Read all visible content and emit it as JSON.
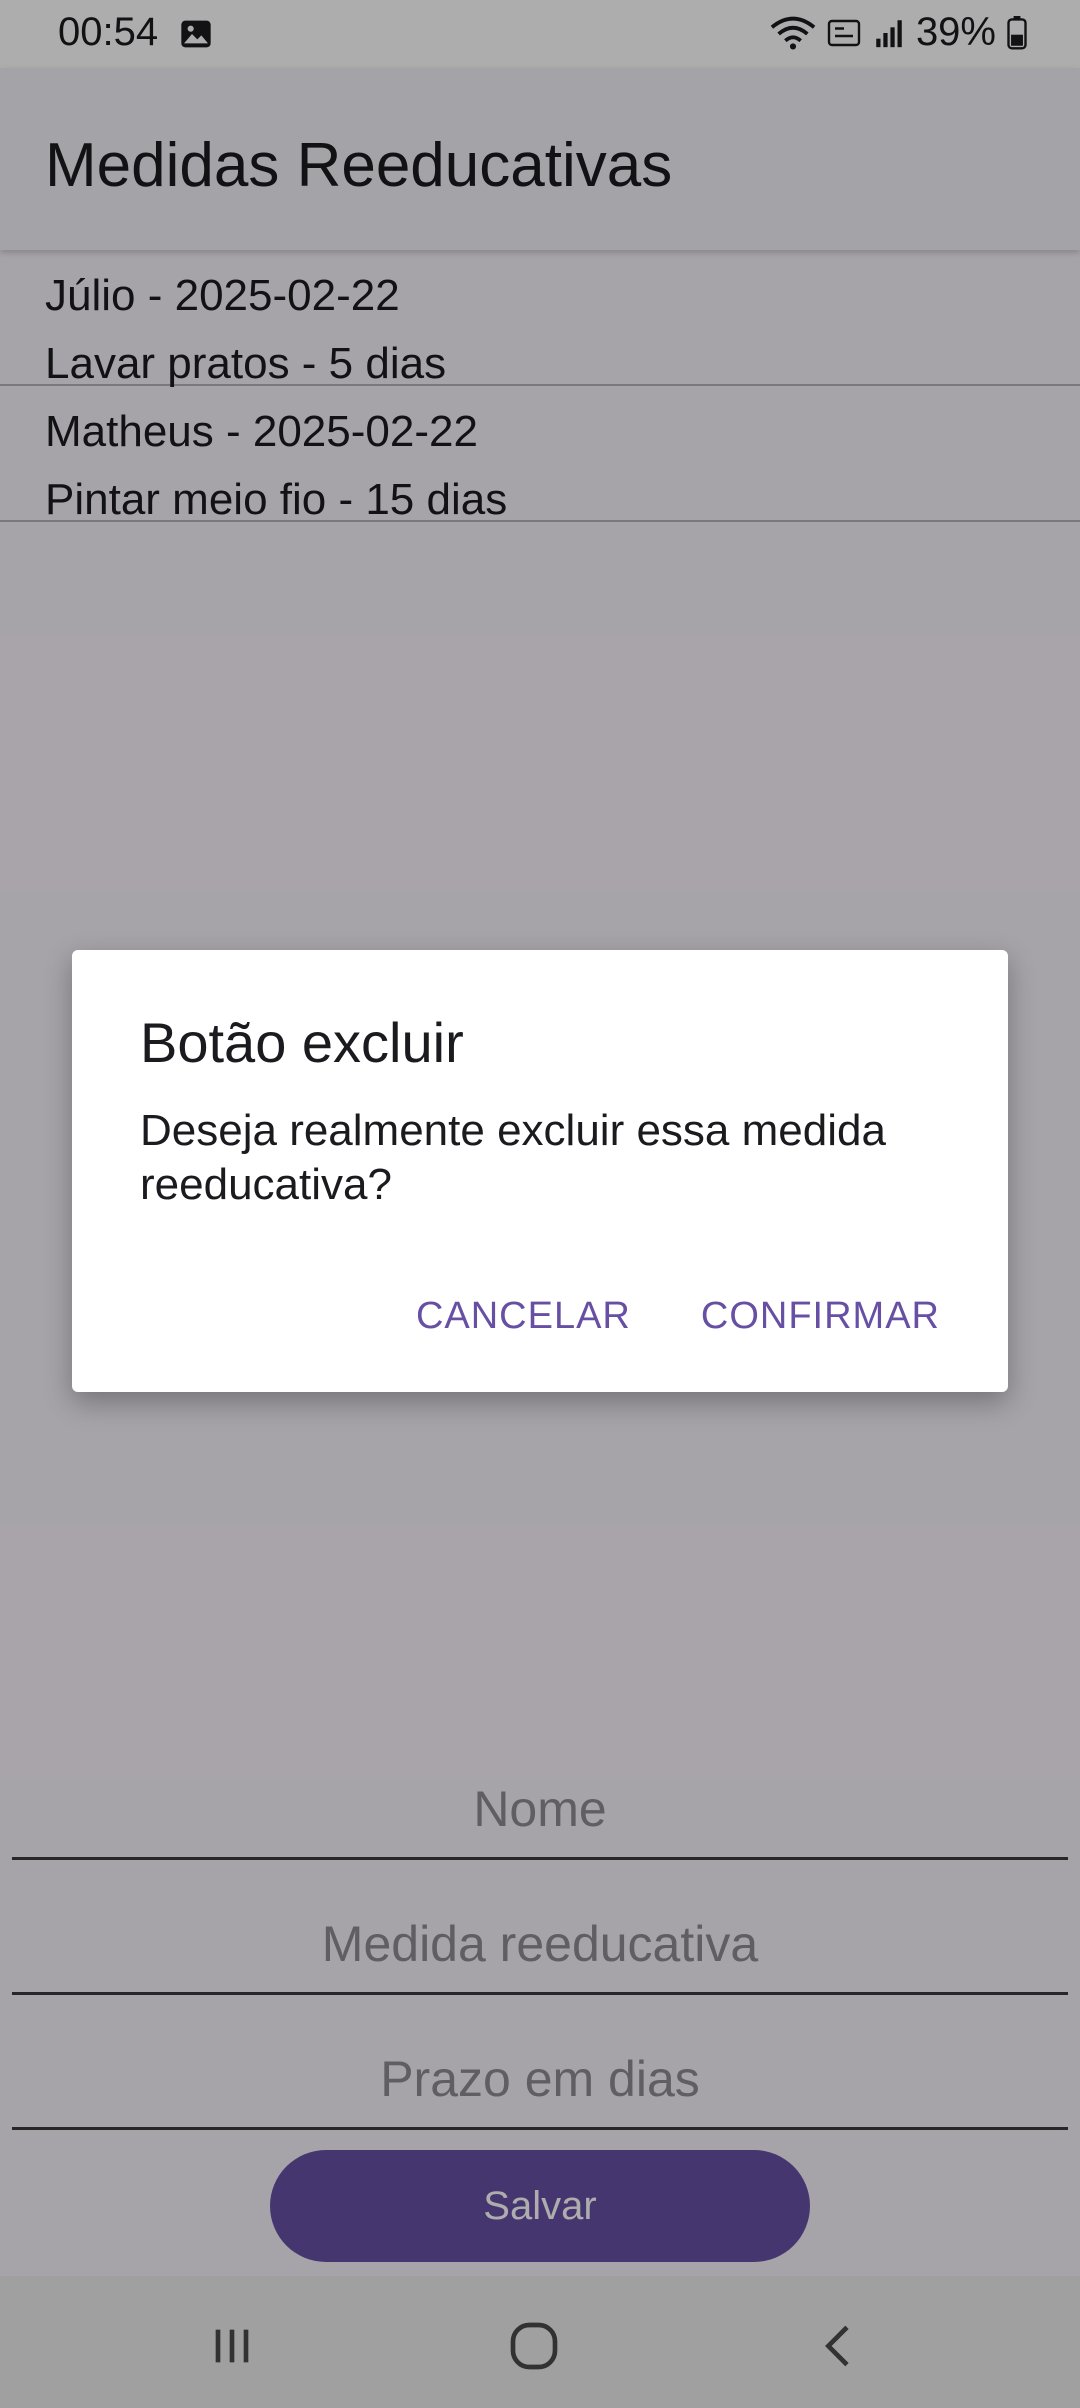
{
  "status": {
    "time": "00:54",
    "battery": "39%"
  },
  "appbar": {
    "title": "Medidas Reeducativas"
  },
  "list": {
    "items": [
      {
        "header": "Júlio - 2025-02-22",
        "detail": "Lavar pratos - 5 dias"
      },
      {
        "header": "Matheus - 2025-02-22",
        "detail": "Pintar meio fio - 15 dias"
      }
    ]
  },
  "form": {
    "name_placeholder": "Nome",
    "measure_placeholder": "Medida reeducativa",
    "days_placeholder": "Prazo em dias",
    "save_label": "Salvar"
  },
  "dialog": {
    "title": "Botão excluir",
    "message": "Deseja realmente excluir essa medida reeducativa?",
    "cancel_label": "CANCELAR",
    "confirm_label": "CONFIRMAR"
  },
  "icons": {
    "status_image": "image-icon",
    "wifi": "wifi-icon",
    "volte": "volte-icon",
    "signal": "signal-icon",
    "battery": "battery-icon",
    "nav_recents": "recents-icon",
    "nav_home": "home-icon",
    "nav_back": "back-icon"
  },
  "colors": {
    "accent": "#6750a4",
    "app_bar": "#f2f0f6",
    "background": "#f7f2fa"
  }
}
